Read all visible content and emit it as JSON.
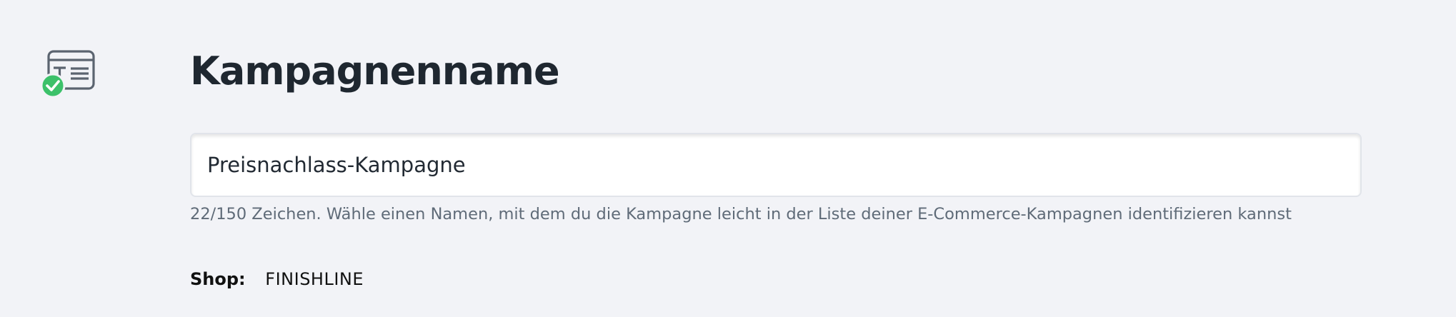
{
  "section": {
    "icon": "text-card-check-icon",
    "title": "Kampagnenname"
  },
  "campaign_name": {
    "value": "Preisnachlass-Kampagne",
    "helper": "22/150 Zeichen. Wähle einen Namen, mit dem du die Kampagne leicht in der Liste deiner E-Commerce-Kampagnen identifizieren kannst"
  },
  "shop": {
    "label": "Shop:",
    "value": "FINISHLINE"
  },
  "colors": {
    "background": "#f2f3f7",
    "check_green": "#3cc16a",
    "icon_stroke": "#5b6470",
    "text_dark": "#1f2730",
    "text_muted": "#5f6b78"
  }
}
